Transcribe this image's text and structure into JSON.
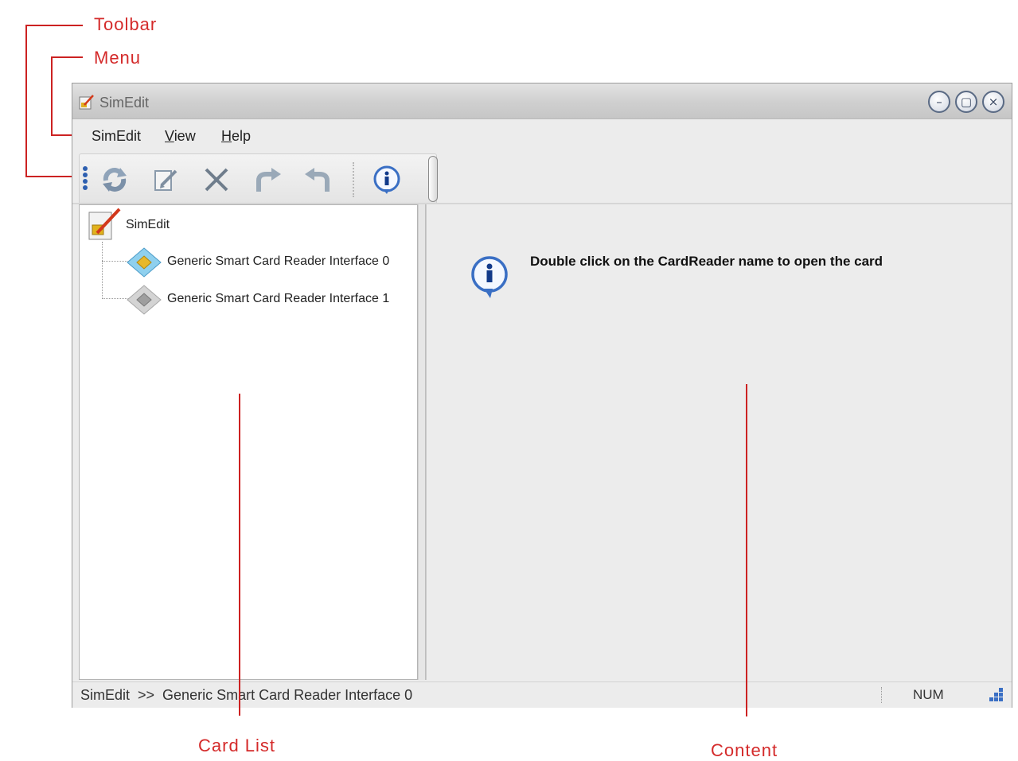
{
  "annotations": {
    "toolbar": "Toolbar",
    "menu": "Menu",
    "card_list": "Card List",
    "content": "Content"
  },
  "window": {
    "title": "SimEdit",
    "title_icon": "simedit-app-icon",
    "controls": [
      "minimize-icon",
      "restore-icon",
      "close-icon"
    ]
  },
  "menubar": {
    "items": [
      {
        "pre": "SimEdit",
        "u": "",
        "post": ""
      },
      {
        "pre": "",
        "u": "V",
        "post": "iew"
      },
      {
        "pre": "",
        "u": "H",
        "post": "elp"
      }
    ]
  },
  "toolbar": {
    "buttons": [
      "refresh-icon",
      "edit-icon",
      "delete-icon",
      "forward-icon",
      "reply-icon",
      "info-icon"
    ]
  },
  "card_list": {
    "root": {
      "label": "SimEdit",
      "icon": "simedit-folder-icon"
    },
    "items": [
      {
        "label": "Generic Smart Card Reader Interface 0",
        "icon": "sim-card-active-icon"
      },
      {
        "label": "Generic Smart Card Reader Interface 1",
        "icon": "sim-card-inactive-icon"
      }
    ]
  },
  "content": {
    "icon": "info-bubble-icon",
    "message": "Double click on the CardReader name to open the card"
  },
  "statusbar": {
    "path": "SimEdit  >>  Generic Smart Card Reader Interface 0",
    "num": "NUM"
  },
  "colors": {
    "annotation": "#d42a2a",
    "window_bg": "#ececec",
    "titlebar": "#cfcfcf",
    "accent_blue": "#3a6fc4"
  }
}
